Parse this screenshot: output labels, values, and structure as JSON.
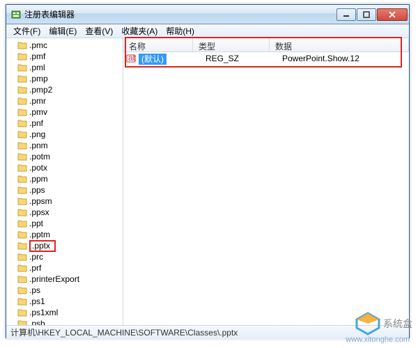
{
  "window": {
    "title": "注册表编辑器"
  },
  "menubar": {
    "file": "文件(F)",
    "edit": "编辑(E)",
    "view": "查看(V)",
    "favorites": "收藏夹(A)",
    "help": "帮助(H)"
  },
  "tree": {
    "items": [
      ".pmc",
      ".pmf",
      ".pml",
      ".pmp",
      ".pmp2",
      ".pmr",
      ".pmv",
      ".pnf",
      ".png",
      ".pnm",
      ".potm",
      ".potx",
      ".ppm",
      ".pps",
      ".ppsm",
      ".ppsx",
      ".ppt",
      ".pptm",
      ".pptx",
      ".prc",
      ".prf",
      ".printerExport",
      ".ps",
      ".ps1",
      ".ps1xml",
      ".psb"
    ],
    "selected": ".pptx"
  },
  "list": {
    "columns": {
      "name": "名称",
      "type": "类型",
      "data": "数据"
    },
    "row": {
      "name": "(默认)",
      "type": "REG_SZ",
      "data": "PowerPoint.Show.12"
    }
  },
  "statusbar": {
    "path": "计算机\\HKEY_LOCAL_MACHINE\\SOFTWARE\\Classes\\.pptx"
  },
  "watermark": {
    "text": "系统盒",
    "url": "www.xitonghe.com"
  }
}
